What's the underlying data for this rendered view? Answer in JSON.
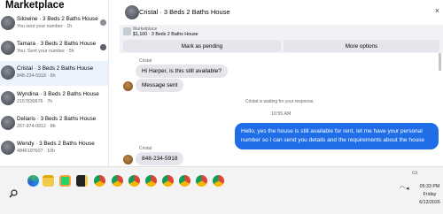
{
  "sidebar": {
    "title": "Marketplace",
    "conversations": [
      {
        "name": "Silowine · 3 Beds 2 Baths House",
        "sub": "You sent your number · 1h"
      },
      {
        "name": "Tamara · 3 Beds 2 Baths House",
        "sub": "You: Sent your number · 5h"
      },
      {
        "name": "Cristal · 3 Beds 2 Baths House",
        "sub": "848-234-5918 · 6h"
      },
      {
        "name": "Wyndina · 3 Beds 2 Baths House",
        "sub": "2157830676 · 7h"
      },
      {
        "name": "Deliaris · 3 Beds 2 Baths House",
        "sub": "267-974-0812 · 8h"
      },
      {
        "name": "Wendy · 3 Beds 2 Baths House",
        "sub": "4846197607 · 10h"
      }
    ]
  },
  "chat": {
    "title": "Cristal · 3 Beds 2 Baths House",
    "close": "×",
    "listing_label": "Marketplace",
    "listing_price": "$1,100 · 3 Beds 2 Baths House",
    "mark_pending": "Mark as pending",
    "more_options": "More options"
  },
  "messages": {
    "sender1": "Cristal",
    "msg1": "Hi Harper, is this still available?",
    "msg2": "Message sent",
    "notice": "Cristal is waiting for your response.",
    "timestamp": "10:55 AM",
    "outgoing": "Hello, yes the house is still available for rent, let me have your personal number so I can send you details and the requirements about the house",
    "sender2": "Cristal",
    "msg3": "848-234-5918"
  },
  "taskbar": {
    "time": "05:33 PM",
    "day": "Friday",
    "date": "6/12/2026"
  },
  "colors": {
    "accent": "#1f6ee8",
    "bubble_in": "#e4e6eb",
    "active_row": "#eaf2fe"
  },
  "icons": [
    "search-icon",
    "edge-icon",
    "file-explorer-icon",
    "whatsapp-icon",
    "sticky-notes-icon",
    "chrome-icon",
    "wifi-icon",
    "speaker-icon",
    "battery-icon",
    "close-icon"
  ]
}
